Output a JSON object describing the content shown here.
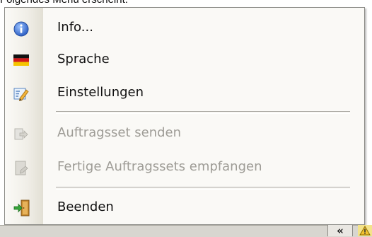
{
  "caption": "Folgendes Menü erscheint:",
  "menu": {
    "items": [
      {
        "label": "Info...",
        "icon": "info-icon",
        "enabled": true
      },
      {
        "label": "Sprache",
        "icon": "german-flag-icon",
        "enabled": true
      },
      {
        "label": "Einstellungen",
        "icon": "settings-pencil-icon",
        "enabled": true
      },
      {
        "label": "Auftragsset senden",
        "icon": "send-document-icon",
        "enabled": false
      },
      {
        "label": "Fertige Auftragssets empfangen",
        "icon": "receive-document-icon",
        "enabled": false
      },
      {
        "label": "Beenden",
        "icon": "exit-door-icon",
        "enabled": true
      }
    ]
  },
  "taskbar": {
    "chevron_label": "«",
    "warning_icon": "warning-icon"
  },
  "colors": {
    "menu_background": "#faf9f6",
    "disabled_text": "#9e9c96",
    "info_blue": "#3b6fd0"
  }
}
